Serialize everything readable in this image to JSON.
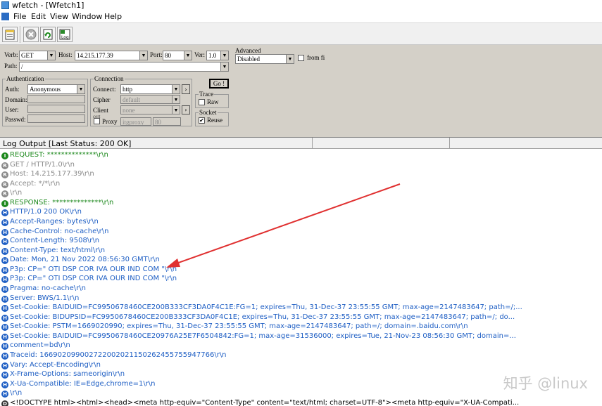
{
  "window": {
    "title": "wfetch - [Wfetch1]"
  },
  "menu": [
    "File",
    "Edit",
    "View",
    "Window",
    "Help"
  ],
  "request": {
    "verb_label": "Verb:",
    "verb": "GET",
    "host_label": "Host:",
    "host": "14.215.177.39",
    "port_label": "Port:",
    "port": "80",
    "ver_label": "Ver:",
    "ver": "1.0",
    "path_label": "Path:",
    "path": "/"
  },
  "authentication": {
    "title": "Authentication",
    "auth_label": "Auth:",
    "auth": "Anonymous",
    "domain_label": "Domain:",
    "user_label": "User:",
    "passwd_label": "Passwd:"
  },
  "connection": {
    "title": "Connection",
    "connect_label": "Connect:",
    "connect": "http",
    "cipher_label": "Cipher",
    "cipher": "default",
    "client_label": "Client",
    "client": "none",
    "proxy_label": "Proxy",
    "proxy": "itgproxy",
    "proxy_port": "80",
    "section_cut": "cert"
  },
  "go_label": "Go !",
  "trace": {
    "title": "Trace",
    "raw_label": "Raw",
    "raw_checked": false
  },
  "socket": {
    "title": "Socket",
    "reuse_label": "Reuse",
    "reuse_checked": true
  },
  "advanced": {
    "title": "Advanced",
    "value": "Disabled",
    "from_label": "from fi"
  },
  "status": {
    "text": "Log Output [Last Status: 200 OK]"
  },
  "log": [
    {
      "kind": "info",
      "badge": "I",
      "text": "REQUEST: **************\\r\\n"
    },
    {
      "kind": "req",
      "badge": "R",
      "text": "GET / HTTP/1.0\\r\\n"
    },
    {
      "kind": "req",
      "badge": "R",
      "text": "Host: 14.215.177.39\\r\\n"
    },
    {
      "kind": "req",
      "badge": "R",
      "text": "Accept: */*\\r\\n"
    },
    {
      "kind": "req",
      "badge": "R",
      "text": "\\r\\n"
    },
    {
      "kind": "info",
      "badge": "I",
      "text": "RESPONSE: **************\\r\\n"
    },
    {
      "kind": "resp",
      "badge": "H",
      "text": "HTTP/1.0 200 OK\\r\\n"
    },
    {
      "kind": "resp",
      "badge": "H",
      "text": "Accept-Ranges: bytes\\r\\n"
    },
    {
      "kind": "resp",
      "badge": "H",
      "text": "Cache-Control: no-cache\\r\\n"
    },
    {
      "kind": "resp",
      "badge": "H",
      "text": "Content-Length: 9508\\r\\n"
    },
    {
      "kind": "resp",
      "badge": "H",
      "text": "Content-Type: text/html\\r\\n"
    },
    {
      "kind": "resp",
      "badge": "H",
      "text": "Date: Mon, 21 Nov 2022 08:56:30 GMT\\r\\n"
    },
    {
      "kind": "resp",
      "badge": "H",
      "text": "P3p: CP=\" OTI DSP COR IVA OUR IND COM \"\\r\\n"
    },
    {
      "kind": "resp",
      "badge": "H",
      "text": "P3p: CP=\" OTI DSP COR IVA OUR IND COM \"\\r\\n"
    },
    {
      "kind": "resp",
      "badge": "H",
      "text": "Pragma: no-cache\\r\\n"
    },
    {
      "kind": "resp",
      "badge": "H",
      "text": "Server: BWS/1.1\\r\\n"
    },
    {
      "kind": "resp",
      "badge": "H",
      "text": "Set-Cookie: BAIDUID=FC9950678460CE200B333CF3DA0F4C1E:FG=1; expires=Thu, 31-Dec-37 23:55:55 GMT; max-age=2147483647; path=/;..."
    },
    {
      "kind": "resp",
      "badge": "H",
      "text": "Set-Cookie: BIDUPSID=FC9950678460CE200B333CF3DA0F4C1E; expires=Thu, 31-Dec-37 23:55:55 GMT; max-age=2147483647; path=/; do..."
    },
    {
      "kind": "resp",
      "badge": "H",
      "text": "Set-Cookie: PSTM=1669020990; expires=Thu, 31-Dec-37 23:55:55 GMT; max-age=2147483647; path=/; domain=.baidu.com\\r\\n"
    },
    {
      "kind": "resp",
      "badge": "H",
      "text": "Set-Cookie: BAIDUID=FC9950678460CE20976A25E7F6504842:FG=1; max-age=31536000; expires=Tue, 21-Nov-23 08:56:30 GMT; domain=..."
    },
    {
      "kind": "resp",
      "badge": "H",
      "text": "comment=bd\\r\\n"
    },
    {
      "kind": "resp",
      "badge": "H",
      "text": "Traceid: 166902099002722002021150262455755947766\\r\\n"
    },
    {
      "kind": "resp",
      "badge": "H",
      "text": "Vary: Accept-Encoding\\r\\n"
    },
    {
      "kind": "resp",
      "badge": "H",
      "text": "X-Frame-Options: sameorigin\\r\\n"
    },
    {
      "kind": "resp",
      "badge": "H",
      "text": "X-Ua-Compatible: IE=Edge,chrome=1\\r\\n"
    },
    {
      "kind": "resp",
      "badge": "H",
      "text": "\\r\\n"
    },
    {
      "kind": "body",
      "badge": "D",
      "text": "<!DOCTYPE html><html><head><meta http-equiv=\"Content-Type\" content=\"text/html; charset=UTF-8\"><meta http-equiv=\"X-UA-Compati..."
    }
  ],
  "watermark": "知乎 @linux",
  "colors": {
    "info": "#1f8a1f",
    "req": "#8a8a8a",
    "resp": "#1f5fc4",
    "arrow": "#e03030"
  }
}
